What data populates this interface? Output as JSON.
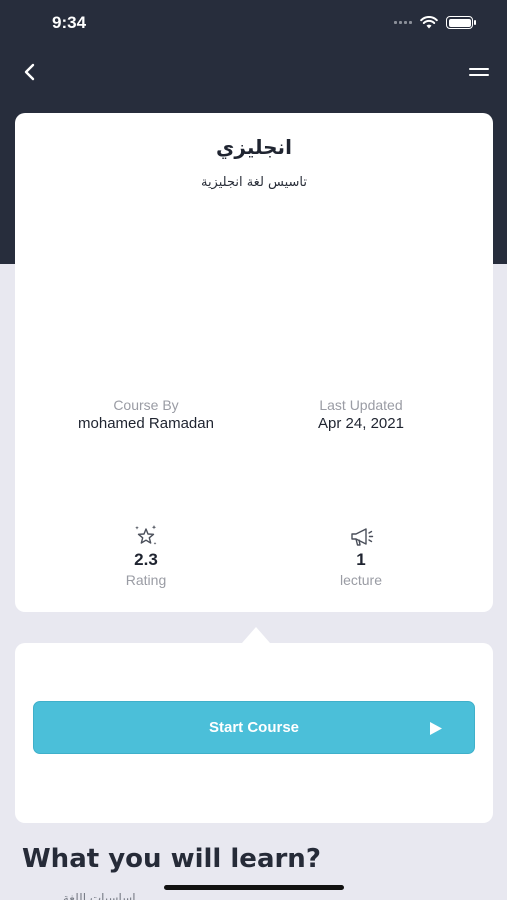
{
  "status": {
    "time": "9:34"
  },
  "course": {
    "title": "انجليزي",
    "subtitle": "تاسيس لغة انجليزية",
    "course_by_label": "Course By",
    "course_by_value": "mohamed Ramadan",
    "last_updated_label": "Last Updated",
    "last_updated_value": "Apr 24, 2021",
    "rating_value": "2.3",
    "rating_label": "Rating",
    "lecture_value": "1",
    "lecture_label": "lecture"
  },
  "actions": {
    "start_label": "Start Course"
  },
  "section": {
    "title": "What you will learn?",
    "first_item_peek": "اساسيات اللغة..."
  },
  "icons": {
    "back": "chevron-left-icon",
    "menu": "hamburger-icon",
    "rating": "sparkle-star-icon",
    "lecture": "megaphone-icon",
    "play": "play-icon"
  },
  "colors": {
    "header": "#272d3c",
    "accent": "#4bbfd9",
    "background": "#e8e8f0"
  }
}
